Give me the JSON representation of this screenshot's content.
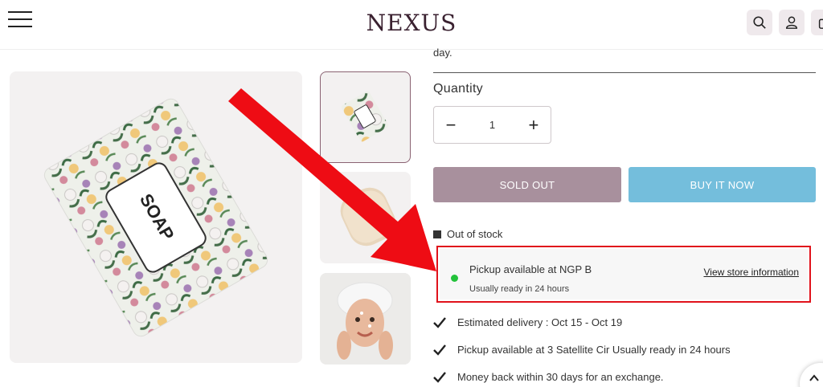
{
  "header": {
    "logo": "NEXUS",
    "icons": [
      "menu-icon",
      "search-icon",
      "user-icon",
      "cart-icon"
    ]
  },
  "product": {
    "description_tail": "day.",
    "quantity_label": "Quantity",
    "quantity_value": "1",
    "decrement": "−",
    "increment": "+",
    "sold_out_label": "SOLD OUT",
    "buy_now_label": "BUY IT NOW",
    "stock_status": "Out of stock",
    "soap_text": "SOAP"
  },
  "pickup": {
    "title": "Pickup available at NGP B",
    "subtitle": "Usually ready in 24 hours",
    "link": "View store information"
  },
  "features": [
    "Estimated delivery : Oct 15 - Oct 19",
    "Pickup available at 3 Satellite Cir Usually ready in 24 hours",
    "Money back within 30 days for an exchange."
  ],
  "colors": {
    "sold_out_bg": "#a8909d",
    "buy_now_bg": "#74bedc",
    "highlight_border": "#e0121b",
    "arrow": "#ee0c14",
    "status_dot": "#23c23b",
    "logo": "#3a2130"
  }
}
